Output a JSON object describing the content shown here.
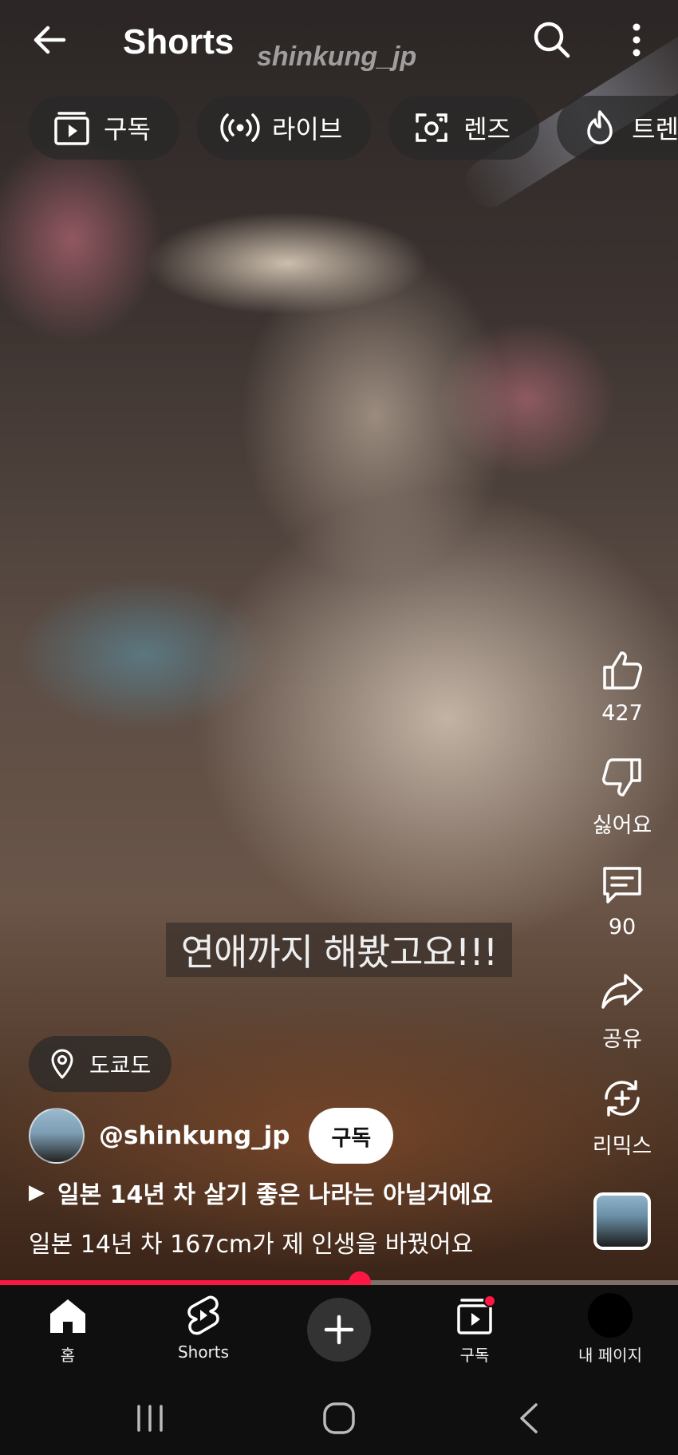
{
  "header": {
    "title": "Shorts",
    "watermark": "shinkung_jp"
  },
  "chips": [
    {
      "label": "구독",
      "icon": "subscriptions-icon"
    },
    {
      "label": "라이브",
      "icon": "live-icon"
    },
    {
      "label": "렌즈",
      "icon": "lens-icon"
    },
    {
      "label": "트렌",
      "icon": "trending-icon"
    }
  ],
  "video": {
    "caption": "연애까지 해봤고요!!!"
  },
  "actions": {
    "like_count": "427",
    "dislike_label": "싫어요",
    "comment_count": "90",
    "share_label": "공유",
    "remix_label": "리믹스"
  },
  "info": {
    "location": "도쿄도",
    "channel_name": "@shinkung_jp",
    "subscribe_label": "구독",
    "music_title": "일본 14년 차 살기 좋은 나라는 아닐거에요",
    "description": "일본 14년 차 167cm가 제 인생을 바꿨어요"
  },
  "progress": {
    "fraction": 0.53
  },
  "bottom_nav": {
    "home_label": "홈",
    "shorts_label": "Shorts",
    "subscriptions_label": "구독",
    "you_label": "내 페이지"
  },
  "colors": {
    "accent": "#ff1744",
    "nav_background": "#0f0f0f"
  }
}
